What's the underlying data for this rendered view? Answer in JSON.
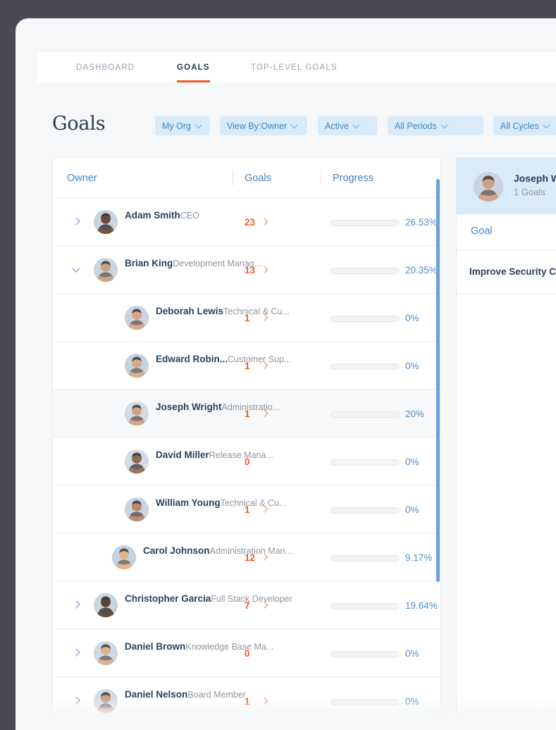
{
  "tabs": [
    {
      "id": "dashboard",
      "label": "DASHBOARD",
      "active": false
    },
    {
      "id": "goals",
      "label": "GOALS",
      "active": true
    },
    {
      "id": "toplevel",
      "label": "TOP-LEVEL GOALS",
      "active": false
    }
  ],
  "page": {
    "title": "Goals"
  },
  "filters": [
    {
      "id": "org",
      "label": "My Org"
    },
    {
      "id": "viewby",
      "label": "View By:Owner"
    },
    {
      "id": "active",
      "label": "Active"
    },
    {
      "id": "periods",
      "label": "All Periods"
    },
    {
      "id": "cycles",
      "label": "All Cycles"
    }
  ],
  "table": {
    "columns": {
      "owner": "Owner",
      "goals": "Goals",
      "progress": "Progress"
    },
    "rows": [
      {
        "name": "Adam Smith",
        "title": "CEO",
        "goals": "23",
        "percent": "26.53%",
        "fill": 26.53,
        "indent": 0,
        "expander": "right",
        "goal_link": true,
        "selected": false,
        "avatar": "#6b4a36"
      },
      {
        "name": "Brian King",
        "title": "Development Manag...",
        "goals": "13",
        "percent": "20.35%",
        "fill": 20.35,
        "indent": 0,
        "expander": "down",
        "goal_link": true,
        "selected": false,
        "avatar": "#c9a184"
      },
      {
        "name": "Deborah Lewis",
        "title": "Technical & Cu...",
        "goals": "1",
        "percent": "0%",
        "fill": 0,
        "indent": 2,
        "expander": "none",
        "goal_link": true,
        "selected": false,
        "avatar": "#d8a58c"
      },
      {
        "name": "Edward Robin...",
        "title": "Customer Sup...",
        "goals": "1",
        "percent": "0%",
        "fill": 0,
        "indent": 2,
        "expander": "none",
        "goal_link": true,
        "selected": false,
        "avatar": "#d2ab8d"
      },
      {
        "name": "Joseph Wright",
        "title": "Administratio...",
        "goals": "1",
        "percent": "20%",
        "fill": 20,
        "indent": 2,
        "expander": "none",
        "goal_link": true,
        "selected": true,
        "avatar": "#cfa188"
      },
      {
        "name": "David Miller",
        "title": "Release Mana...",
        "goals": "0",
        "percent": "0%",
        "fill": 0,
        "indent": 2,
        "expander": "none",
        "goal_link": false,
        "selected": false,
        "avatar": "#8d6b55"
      },
      {
        "name": "William Young",
        "title": "Technical & Cu...",
        "goals": "1",
        "percent": "0%",
        "fill": 0,
        "indent": 2,
        "expander": "none",
        "goal_link": true,
        "selected": false,
        "avatar": "#b9896a"
      },
      {
        "name": "Carol Johnson",
        "title": "Administration Man...",
        "goals": "12",
        "percent": "9.17%",
        "fill": 9.17,
        "indent": 1,
        "expander": "none",
        "goal_link": true,
        "selected": false,
        "avatar": "#e0b48e"
      },
      {
        "name": "Christopher Garcia",
        "title": "Full Stack Developer",
        "goals": "7",
        "percent": "19.64%",
        "fill": 19.64,
        "indent": 0,
        "expander": "right",
        "goal_link": true,
        "selected": false,
        "avatar": "#5c4232"
      },
      {
        "name": "Daniel Brown",
        "title": "Knowledge Base Ma...",
        "goals": "0",
        "percent": "0%",
        "fill": 0,
        "indent": 0,
        "expander": "right",
        "goal_link": false,
        "selected": false,
        "avatar": "#d9b294"
      },
      {
        "name": "Daniel Nelson",
        "title": "Board Member",
        "goals": "1",
        "percent": "0%",
        "fill": 0,
        "indent": 0,
        "expander": "right",
        "goal_link": true,
        "selected": false,
        "avatar": "#c8a184"
      }
    ]
  },
  "detail": {
    "owner_name": "Joseph Wright",
    "owner_sub": "1 Goals",
    "column": "Goal",
    "goals": [
      {
        "title": "Improve Security Compli"
      }
    ]
  },
  "colors": {
    "accent_orange": "#ef5a28",
    "accent_blue": "#4a90d9",
    "filter_bg": "#d9eaf9",
    "frame": "#4a4a55",
    "page_bg": "#f6f7f8",
    "name_text": "#2b4060",
    "muted_text": "#8e959e"
  }
}
